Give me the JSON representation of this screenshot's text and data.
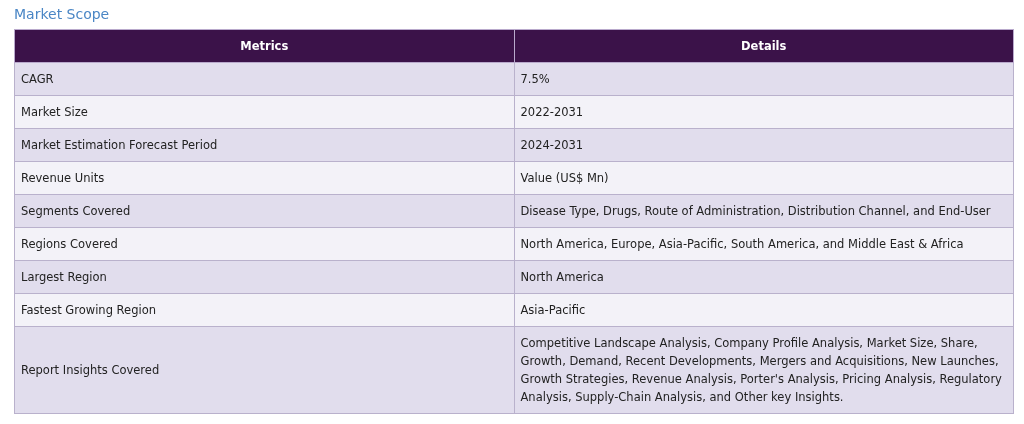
{
  "title": "Market Scope",
  "table": {
    "columns": [
      "Metrics",
      "Details"
    ],
    "rows": [
      {
        "metric": "CAGR",
        "details": "7.5%"
      },
      {
        "metric": "Market Size",
        "details": "2022-2031"
      },
      {
        "metric": "Market Estimation Forecast Period",
        "details": "2024-2031"
      },
      {
        "metric": "Revenue Units",
        "details": "Value (US$ Mn)"
      },
      {
        "metric": "Segments Covered",
        "details": "Disease Type, Drugs, Route of Administration, Distribution Channel, and End-User"
      },
      {
        "metric": "Regions Covered",
        "details": "North America, Europe, Asia-Pacific, South America, and Middle East & Africa"
      },
      {
        "metric": "Largest Region",
        "details": "North America"
      },
      {
        "metric": "Fastest Growing Region",
        "details": "Asia-Pacific"
      },
      {
        "metric": "Report Insights Covered",
        "details": "Competitive Landscape Analysis, Company Profile Analysis, Market Size, Share, Growth, Demand, Recent Developments, Mergers and Acquisitions, New Launches, Growth Strategies, Revenue Analysis, Porter's Analysis, Pricing Analysis, Regulatory Analysis, Supply-Chain Analysis, and Other key Insights."
      }
    ]
  }
}
